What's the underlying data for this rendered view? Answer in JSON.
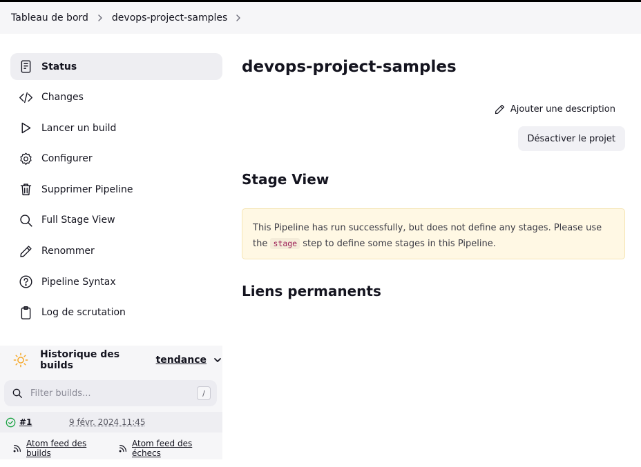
{
  "breadcrumbs": [
    {
      "label": "Tableau de bord"
    },
    {
      "label": "devops-project-samples"
    }
  ],
  "sidebar": {
    "items": [
      {
        "label": "Status",
        "icon": "status-icon"
      },
      {
        "label": "Changes",
        "icon": "code-icon"
      },
      {
        "label": "Lancer un build",
        "icon": "play-icon"
      },
      {
        "label": "Configurer",
        "icon": "gear-icon"
      },
      {
        "label": "Supprimer Pipeline",
        "icon": "trash-icon"
      },
      {
        "label": "Full Stage View",
        "icon": "search-icon"
      },
      {
        "label": "Renommer",
        "icon": "pencil-icon"
      },
      {
        "label": "Pipeline Syntax",
        "icon": "help-icon"
      },
      {
        "label": "Log de scrutation",
        "icon": "clipboard-icon"
      }
    ]
  },
  "build_history": {
    "title": "Historique des builds",
    "trend_label": "tendance",
    "filter_placeholder": "Filter builds...",
    "filter_shortcut": "/",
    "builds": [
      {
        "number": "#1",
        "date": "9 févr. 2024 11:45",
        "status": "success"
      }
    ],
    "feeds": {
      "all": "Atom feed des builds",
      "failures": "Atom feed des échecs"
    }
  },
  "main": {
    "title": "devops-project-samples",
    "add_description": "Ajouter une description",
    "disable_button": "Désactiver le projet",
    "stage_view_title": "Stage View",
    "notice": {
      "text_before": "This Pipeline has run successfully, but does not define any stages. Please use the ",
      "code": "stage",
      "text_after": " step to define some stages in this Pipeline."
    },
    "permalinks_title": "Liens permanents"
  },
  "colors": {
    "success": "#1ea446",
    "notice_bg": "#fff8e4",
    "trend_icon": "#f5a623"
  }
}
